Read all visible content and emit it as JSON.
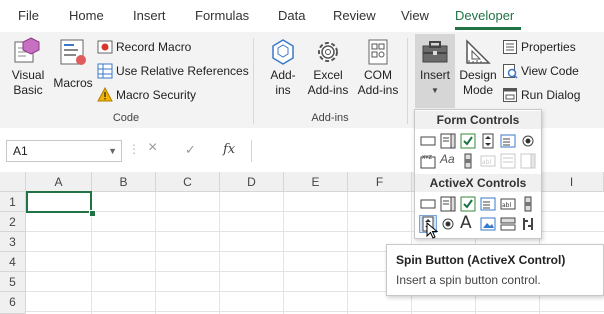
{
  "tabs": [
    "File",
    "Home",
    "Insert",
    "Formulas",
    "Data",
    "Review",
    "View",
    "Developer"
  ],
  "active_tab": "Developer",
  "accent_color": "#217346",
  "ribbon": {
    "code": {
      "visual_basic": [
        "Visual",
        "Basic"
      ],
      "macros": "Macros",
      "record_macro": "Record Macro",
      "use_relative_references": "Use Relative References",
      "macro_security": "Macro Security",
      "label": "Code"
    },
    "addins": {
      "addins": [
        "Add-",
        "ins"
      ],
      "excel_addins": [
        "Excel",
        "Add-ins"
      ],
      "com_addins": [
        "COM",
        "Add-ins"
      ],
      "label": "Add-ins"
    },
    "controls": {
      "insert": "Insert",
      "design_mode": [
        "Design",
        "Mode"
      ],
      "properties": "Properties",
      "view_code": "View Code",
      "run_dialog": "Run Dialog"
    }
  },
  "formula_bar": {
    "name_box": "A1",
    "cancel_icon": "×",
    "enter_icon": "✓",
    "fx": "fx",
    "formula": ""
  },
  "sheet": {
    "columns": [
      "A",
      "B",
      "C",
      "D",
      "E",
      "F",
      "G",
      "H",
      "I"
    ],
    "rows": [
      "1",
      "2",
      "3",
      "4",
      "5",
      "6"
    ],
    "active_cell": "A1"
  },
  "dropdown": {
    "form_controls_header": "Form Controls",
    "activex_controls_header": "ActiveX Controls",
    "form_controls": [
      "button",
      "combo-box",
      "check-box",
      "spin-button",
      "list-box",
      "option-button",
      "group-box",
      "label",
      "scroll-bar",
      "text-field",
      "combo-list-edit",
      "combo-drop-down"
    ],
    "activex_controls": [
      "command-button",
      "combo-box",
      "check-box",
      "list-box",
      "text-box",
      "scroll-bar",
      "spin-button",
      "option-button",
      "label",
      "image",
      "toggle-button",
      "more-controls"
    ],
    "hovered": "spin-button"
  },
  "tooltip": {
    "title": "Spin Button (ActiveX Control)",
    "description": "Insert a spin button control."
  }
}
